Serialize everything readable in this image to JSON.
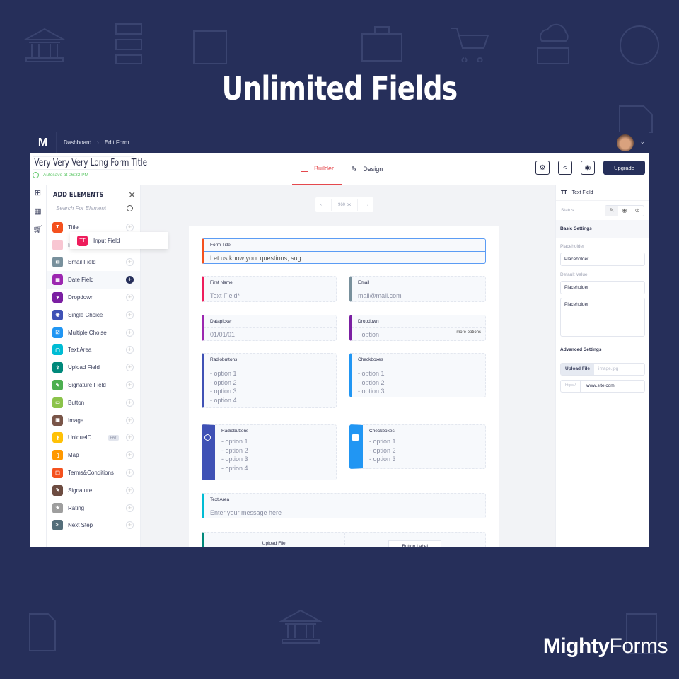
{
  "headline": "Unlimited Fields",
  "brand": {
    "bold": "Mighty",
    "light": "Forms"
  },
  "topbar": {
    "logo": "M",
    "breadcrumbs": [
      "Dashboard",
      "Edit Form"
    ],
    "breadcrumb_separator": "›"
  },
  "header": {
    "form_title": "Very Very Very Long Form Title",
    "autosave": "Autosave at 06:32 PM",
    "tabs": [
      {
        "label": "Builder",
        "active": true
      },
      {
        "label": "Design",
        "active": false
      }
    ],
    "actions": {
      "settings_icon": "gear-icon",
      "share_icon": "share-icon",
      "preview_icon": "eye-icon",
      "upgrade_label": "Upgrade"
    }
  },
  "elements_panel": {
    "title": "ADD ELEMENTS",
    "search_placeholder": "Search For Element",
    "dragging": {
      "label": "Input Field",
      "icon": "TT"
    },
    "items": [
      {
        "label": "Title",
        "color": "#f4511e",
        "icon": "T"
      },
      {
        "label": "Input Field",
        "color": "#f8c6d2",
        "icon": ""
      },
      {
        "label": "Email Field",
        "color": "#78909c",
        "icon": "✉"
      },
      {
        "label": "Date Field",
        "color": "#9c27b0",
        "icon": "▦",
        "hover": true
      },
      {
        "label": "Dropdown",
        "color": "#7b1fa2",
        "icon": "▾"
      },
      {
        "label": "Single Choice",
        "color": "#3f51b5",
        "icon": "◉"
      },
      {
        "label": "Multiple Choise",
        "color": "#2196f3",
        "icon": "☑"
      },
      {
        "label": "Text Area",
        "color": "#00bcd4",
        "icon": "▢"
      },
      {
        "label": "Upload Field",
        "color": "#00897b",
        "icon": "⇪"
      },
      {
        "label": "Signature Field",
        "color": "#4caf50",
        "icon": "✎"
      },
      {
        "label": "Button",
        "color": "#8bc34a",
        "icon": "▭"
      },
      {
        "label": "Image",
        "color": "#795548",
        "icon": "▣"
      },
      {
        "label": "UniqueID",
        "color": "#ffc107",
        "icon": "⚷",
        "badge": "PAY"
      },
      {
        "label": "Map",
        "color": "#ff9800",
        "icon": "▯"
      },
      {
        "label": "Terms&Conditions",
        "color": "#f4511e",
        "icon": "❏"
      },
      {
        "label": "Signature",
        "color": "#6d4c41",
        "icon": "✎"
      },
      {
        "label": "Rating",
        "color": "#9e9e9e",
        "icon": "★"
      },
      {
        "label": "Next Step",
        "color": "#546e7a",
        "icon": ">|"
      }
    ]
  },
  "canvas": {
    "width_label": "960 px",
    "fields": {
      "form_title": {
        "label": "Form Title",
        "value": "Let us know your questions, sug"
      },
      "first_name": {
        "label": "First Name",
        "value": "Text Field*"
      },
      "email": {
        "label": "Email",
        "value": "mail@mail.com"
      },
      "datepicker": {
        "label": "Datapicker",
        "value": "01/01/01"
      },
      "dropdown": {
        "label": "Dropdown",
        "value": "- option",
        "more": "more options"
      },
      "radio1": {
        "label": "Radiobuttons",
        "options": [
          "- option 1",
          "- option 2",
          "- option 3",
          "- option 4"
        ]
      },
      "check1": {
        "label": "Checkboxes",
        "options": [
          "- option 1",
          "- option 2",
          "- option 3"
        ]
      },
      "radio2": {
        "label": "Radiobuttons",
        "options": [
          "- option 1",
          "- option 2",
          "- option 3",
          "- option 4"
        ]
      },
      "check2": {
        "label": "Checkboxes",
        "options": [
          "- option 1",
          "- option 2",
          "- option 3"
        ]
      },
      "textarea": {
        "label": "Text Area",
        "value": "Enter your message here"
      },
      "upload": {
        "label": "Upload File",
        "button": "Button Label"
      }
    }
  },
  "settings_panel": {
    "field_type": "Text Field",
    "status_label": "Status",
    "basic_title": "Basic Settings",
    "placeholder_label": "Placeholder",
    "placeholder_value": "Placeholder",
    "default_label": "Default Value",
    "default_value": "Placeholder",
    "textarea_value": "Placeholder",
    "advanced_title": "Advanced Settings",
    "upload_button": "Upload File",
    "upload_value": "image.jpg",
    "url_prefix": "https:/",
    "url_value": "www.site.com"
  }
}
